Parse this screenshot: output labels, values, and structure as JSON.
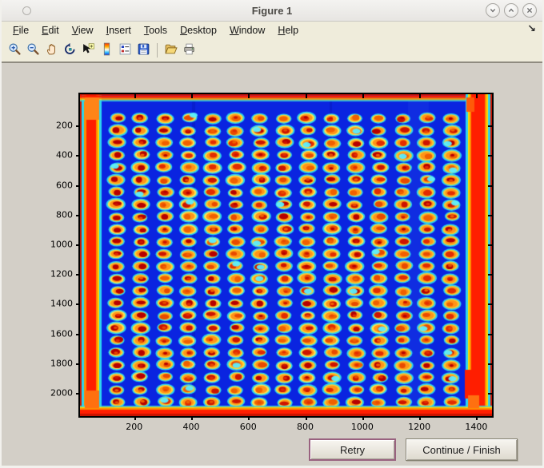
{
  "window": {
    "title": "Figure 1",
    "controls": [
      {
        "name": "minimize",
        "icon": "chevron-down-icon"
      },
      {
        "name": "maximize",
        "icon": "chevron-up-icon"
      },
      {
        "name": "close",
        "icon": "close-icon"
      }
    ]
  },
  "menu": {
    "items": [
      {
        "label": "File"
      },
      {
        "label": "Edit"
      },
      {
        "label": "View"
      },
      {
        "label": "Insert"
      },
      {
        "label": "Tools"
      },
      {
        "label": "Desktop"
      },
      {
        "label": "Window"
      },
      {
        "label": "Help"
      }
    ],
    "mnemonic_index": 0,
    "dock_arrow_glyph": "↘"
  },
  "toolbar": {
    "buttons": [
      {
        "name": "zoom-in"
      },
      {
        "name": "zoom-out"
      },
      {
        "name": "pan"
      },
      {
        "name": "rotate-3d"
      },
      {
        "name": "data-cursor"
      },
      {
        "name": "insert-colorbar"
      },
      {
        "name": "insert-legend"
      },
      {
        "name": "save-figure"
      },
      {
        "name": "separator"
      },
      {
        "name": "open-file"
      },
      {
        "name": "print-figure"
      }
    ]
  },
  "chart_data": {
    "type": "heatmap",
    "title": "",
    "xlabel": "",
    "ylabel": "",
    "colormap": "jet",
    "x_ticks": [
      200,
      400,
      600,
      800,
      1000,
      1200,
      1400
    ],
    "y_ticks": [
      200,
      400,
      600,
      800,
      1000,
      1200,
      1400,
      1600,
      1800,
      2000
    ],
    "x_range": [
      10,
      1455
    ],
    "y_range": [
      -10,
      2155
    ],
    "y_axis_direction": "down",
    "grid": {
      "rows": 24,
      "cols": 16,
      "total_spots": 384
    },
    "description": "Pseudocolor (jet) image of a scanned microarray/microplate: 24 rows x 16 columns of warm spots (red cores, orange-yellow rims, cyan halos) on a deep blue field, framed by saturated red bands along all four edges",
    "render": {
      "bg": "#0a24e0",
      "halo": "rgba(46,226,242,0.92)",
      "body_colors": [
        "#ffd838",
        "#ffcf2e",
        "#ffe14e",
        "#f8c930"
      ],
      "ring": "#ff9418",
      "core_colors": [
        "#e22c00",
        "#cc1400",
        "#e84a00",
        "#b60000",
        "#f06000"
      ],
      "cyan_splash": "rgba(90,240,255,0.95)",
      "band_red": "#ff1e00",
      "band_orange": "#ff8c00",
      "band_yellow": "#ffd800",
      "band_cyan": "#2cd4f0",
      "band_dark_red": "#c81400",
      "x0": 46,
      "y0": 30,
      "dx": 29.85,
      "dy": 15.45
    }
  },
  "actions": {
    "retry_label": "Retry",
    "continue_label": "Continue / Finish"
  }
}
